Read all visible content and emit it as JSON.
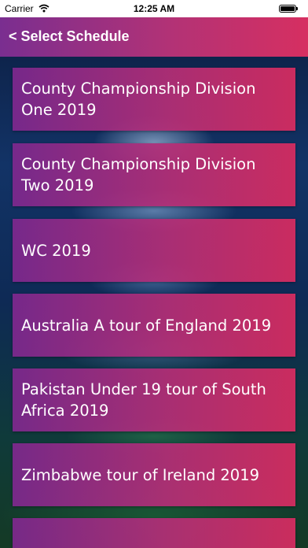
{
  "status_bar": {
    "carrier": "Carrier",
    "wifi_icon": "wifi-icon",
    "time": "12:25 AM",
    "battery_icon": "battery-full-icon"
  },
  "nav": {
    "back_label": "< Select Schedule"
  },
  "colors": {
    "nav_gradient_start": "#7a2e90",
    "nav_gradient_end": "#d62f61",
    "card_gradient_start": "#7e288e",
    "card_gradient_end": "#d42c60",
    "text": "#ffffff"
  },
  "schedules": [
    {
      "label": "County Championship Division One 2019"
    },
    {
      "label": "County Championship Division Two 2019"
    },
    {
      "label": "WC 2019"
    },
    {
      "label": "Australia A tour of England 2019"
    },
    {
      "label": "Pakistan Under 19 tour of South Africa 2019"
    },
    {
      "label": "Zimbabwe tour of Ireland 2019"
    },
    {
      "label": ""
    }
  ]
}
